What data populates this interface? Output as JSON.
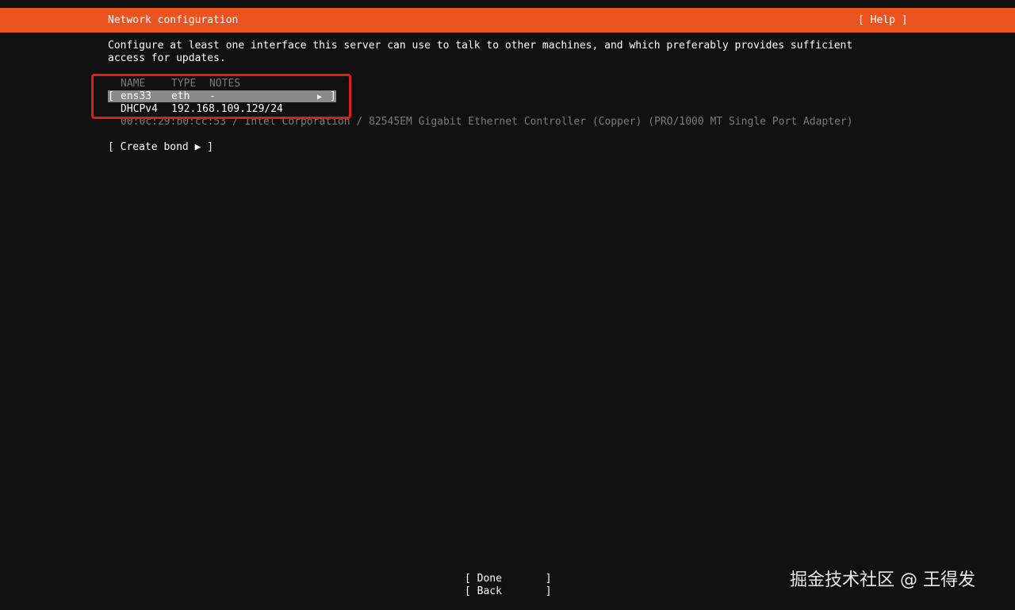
{
  "header": {
    "title": "Network configuration",
    "help_label": "[ Help ]"
  },
  "description": {
    "line1": "Configure at least one interface this server can use to talk to other machines, and which preferably provides sufficient",
    "line2": "access for updates."
  },
  "interfaces_table": {
    "columns": {
      "name": "NAME",
      "type": "TYPE",
      "notes": "NOTES"
    },
    "rows": [
      {
        "open_bracket": "[",
        "name": "ens33",
        "type": "eth",
        "notes": "-",
        "arrow": "▶",
        "close_bracket": "]",
        "address_method": "DHCPv4",
        "address": "192.168.109.129/24",
        "hardware_info": "00:0c:29:b0:cc:53 / Intel Corporation / 82545EM Gigabit Ethernet Controller (Copper) (PRO/1000 MT Single Port Adapter)"
      }
    ]
  },
  "create_bond_label": "[ Create bond ▶ ]",
  "buttons": {
    "done": "[ Done       ]",
    "back": "[ Back       ]"
  },
  "watermark": "掘金技术社区 @ 王得发",
  "colors": {
    "header_bg": "#e95420",
    "background": "#111111",
    "selection_bg": "#8a8a8a",
    "highlight_border": "#e01d1d"
  }
}
